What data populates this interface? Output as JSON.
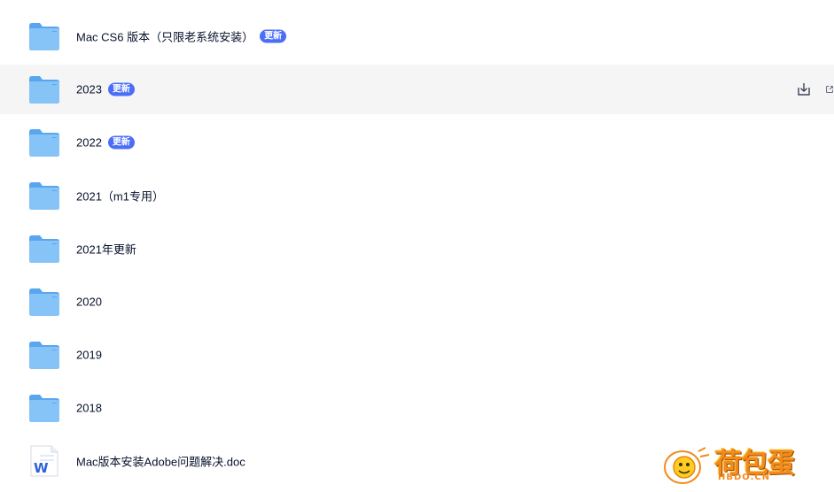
{
  "colors": {
    "folder": "#6fb5f2",
    "badge": "#4a6ef5",
    "hover_row": "#f5f5f6",
    "watermark": "#f28a1c"
  },
  "items": [
    {
      "name": "Mac CS6 版本（只限老系统安装）",
      "badge": "更新",
      "type": "folder",
      "icon": "folder-icon"
    },
    {
      "name": "2023",
      "badge": "更新",
      "type": "folder",
      "icon": "folder-icon",
      "hovered": true
    },
    {
      "name": "2022",
      "badge": "更新",
      "type": "folder",
      "icon": "folder-icon"
    },
    {
      "name": "2021（m1专用）",
      "badge": "",
      "type": "folder",
      "icon": "folder-icon"
    },
    {
      "name": "2021年更新",
      "badge": "",
      "type": "folder",
      "icon": "folder-icon"
    },
    {
      "name": "2020",
      "badge": "",
      "type": "folder",
      "icon": "folder-icon"
    },
    {
      "name": "2019",
      "badge": "",
      "type": "folder",
      "icon": "folder-icon"
    },
    {
      "name": "2018",
      "badge": "",
      "type": "folder",
      "icon": "folder-icon"
    },
    {
      "name": "Mac版本安装Adobe问题解决.doc",
      "badge": "",
      "type": "doc",
      "icon": "word-doc-icon"
    }
  ],
  "row_actions": {
    "download_icon": "download-icon",
    "share_icon": "share-icon"
  },
  "watermark": {
    "title": "荷包蛋",
    "subtitle": "HBDO.CN"
  }
}
